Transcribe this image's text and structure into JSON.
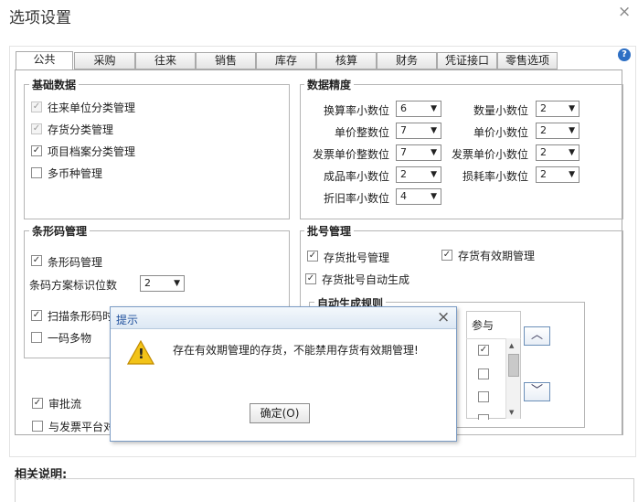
{
  "window": {
    "title": "选项设置",
    "close_glyph": "×"
  },
  "tabs": [
    {
      "label": "公共",
      "active": true
    },
    {
      "label": "采购"
    },
    {
      "label": "往来"
    },
    {
      "label": "销售"
    },
    {
      "label": "库存"
    },
    {
      "label": "核算"
    },
    {
      "label": "财务"
    },
    {
      "label": "凭证接口"
    },
    {
      "label": "零售选项"
    }
  ],
  "help_glyph": "?",
  "basic": {
    "title": "基础数据",
    "items": [
      {
        "label": "往来单位分类管理",
        "mark": "✓"
      },
      {
        "label": "存货分类管理",
        "mark": "✓"
      },
      {
        "label": "项目档案分类管理",
        "mark": "✓"
      },
      {
        "label": "多币种管理",
        "mark": ""
      }
    ]
  },
  "precision": {
    "title": "数据精度",
    "fields": [
      {
        "label": "换算率小数位",
        "value": "6"
      },
      {
        "label": "数量小数位",
        "value": "2"
      },
      {
        "label": "单价整数位",
        "value": "7"
      },
      {
        "label": "单价小数位",
        "value": "2"
      },
      {
        "label": "发票单价整数位",
        "value": "7"
      },
      {
        "label": "发票单价小数位",
        "value": "2"
      },
      {
        "label": "成品率小数位",
        "value": "2"
      },
      {
        "label": "损耗率小数位",
        "value": "2"
      },
      {
        "label": "折旧率小数位",
        "value": "4"
      }
    ]
  },
  "barcode": {
    "title": "条形码管理",
    "enable": {
      "label": "条形码管理",
      "mark": "✓"
    },
    "digits_label": "条码方案标识位数",
    "digits_value": "2",
    "scan": {
      "label": "扫描条形码时",
      "mark": "✓"
    },
    "multi": {
      "label": "一码多物",
      "mark": ""
    }
  },
  "approval": {
    "label": "审批流",
    "mark": "✓"
  },
  "invoice_platform": {
    "label": "与发票平台对",
    "mark": ""
  },
  "batch": {
    "title": "批号管理",
    "batch_mgmt": {
      "label": "存货批号管理",
      "mark": "✓"
    },
    "expiry_mgmt": {
      "label": "存货有效期管理",
      "mark": "✓"
    },
    "auto_gen": {
      "label": "存货批号自动生成",
      "mark": "✓"
    },
    "rule_title": "自动生成规则",
    "col_participate": "参与",
    "rows": [
      {
        "mark": "✓"
      },
      {
        "mark": ""
      },
      {
        "mark": ""
      },
      {
        "mark": ""
      }
    ],
    "up_glyph": "︿",
    "down_glyph": "﹀"
  },
  "remarks": {
    "title": "相关说明:"
  },
  "dialog": {
    "title": "提示",
    "close_glyph": "×",
    "message": "存在有效期管理的存货，不能禁用存货有效期管理!",
    "ok_label": "确定(O)",
    "warning_glyph": "!"
  },
  "colors": {
    "dialog_title": "#1e4f9c",
    "warning": "#f2c318"
  }
}
